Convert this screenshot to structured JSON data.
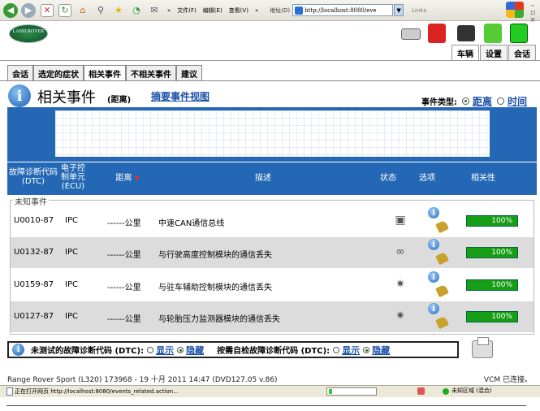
{
  "browser": {
    "menu": [
      "文件(F)",
      "编辑(E)",
      "查看(V)"
    ],
    "address_label": "地址(D)",
    "address": "http://localhost:8080/eve",
    "links": "Links",
    "chevron": "»"
  },
  "header": {
    "logo_text": "LAND ROVER",
    "top_tabs": [
      "车辆",
      "设置",
      "会话"
    ]
  },
  "sub_tabs": [
    "会话",
    "选定的症状",
    "相关事件",
    "不相关事件",
    "建议"
  ],
  "page": {
    "title": "相关事件",
    "subtitle": "(距离)",
    "summary_link": "摘要事件视图",
    "event_type_label": "事件类型:",
    "event_type_distance": "距离",
    "event_type_time": "时间"
  },
  "table": {
    "headers": {
      "dtc": "故障诊断代码 (DTC)",
      "ecu": "电子控制单元 (ECU)",
      "distance": "距离",
      "description": "描述",
      "status": "状态",
      "options": "选项",
      "relevance": "相关性"
    },
    "group_label": "未知事件",
    "rows": [
      {
        "dtc": "U0010-87",
        "ecu": "IPC",
        "distance": "------公里",
        "description": "中速CAN通信总线",
        "relevance": "100%",
        "relevance_value": 1.0,
        "status_icon": "network-icon"
      },
      {
        "dtc": "U0132-87",
        "ecu": "IPC",
        "distance": "------公里",
        "description": "与行驶高度控制模块的通信丢失",
        "relevance": "100%",
        "relevance_value": 1.0,
        "status_icon": "link-broken-icon"
      },
      {
        "dtc": "U0159-87",
        "ecu": "IPC",
        "distance": "------公里",
        "description": "与驻车辅助控制模块的通信丢失",
        "relevance": "100%",
        "relevance_value": 1.0,
        "status_icon": "link-broken-icon"
      },
      {
        "dtc": "U0127-87",
        "ecu": "IPC",
        "distance": "------公里",
        "description": "与轮胎压力监测器模块的通信丢失",
        "relevance": "100%",
        "relevance_value": 1.0,
        "status_icon": "link-broken-icon"
      }
    ]
  },
  "bottom": {
    "untested_label": "未测试的故障诊断代码 (DTC):",
    "show": "显示",
    "hide": "隐藏",
    "self_test_label": "按需自检故障诊断代码 (DTC):"
  },
  "footer": {
    "vehicle": "Range Rover Sport (L320) 173968 - 19 十月 2011 14:47 (DVD127.05 v.86)",
    "vcm": "VCM 已连接。"
  },
  "statusbar": {
    "text": "正在打开网页 http://localhost:8080/events_related.action...",
    "zone": "未知区域 (混合)"
  },
  "colors": {
    "header_blue": "#2468b5",
    "relevance_green": "#169e16",
    "link_blue": "#1a4fa8"
  }
}
